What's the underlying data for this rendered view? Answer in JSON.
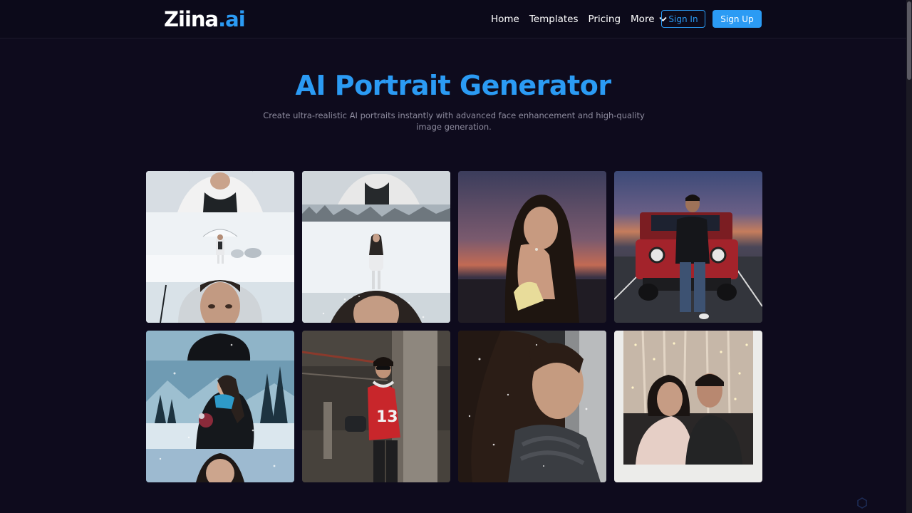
{
  "header": {
    "logo_main": "Ziina",
    "logo_accent": ".ai",
    "nav": [
      "Home",
      "Templates",
      "Pricing",
      "More"
    ],
    "sign_in": "Sign In",
    "sign_up": "Sign Up"
  },
  "hero": {
    "title": "AI Portrait Generator",
    "subtitle": "Create ultra-realistic AI portraits instantly with advanced face enhancement and high-quality image generation."
  },
  "gallery": [
    {
      "name": "snow-umbrella-man-collage"
    },
    {
      "name": "snow-woman-collage"
    },
    {
      "name": "sunset-beach-woman"
    },
    {
      "name": "man-with-red-jeep"
    },
    {
      "name": "snowy-forest-woman-collage"
    },
    {
      "name": "parking-garage-jersey-13",
      "jersey": "13"
    },
    {
      "name": "snowy-scarf-woman-closeup"
    },
    {
      "name": "couple-polaroid"
    }
  ],
  "colors": {
    "background": "#0e0b1d",
    "accent": "#2b9bf4",
    "subtitle": "#8e8c9f"
  }
}
